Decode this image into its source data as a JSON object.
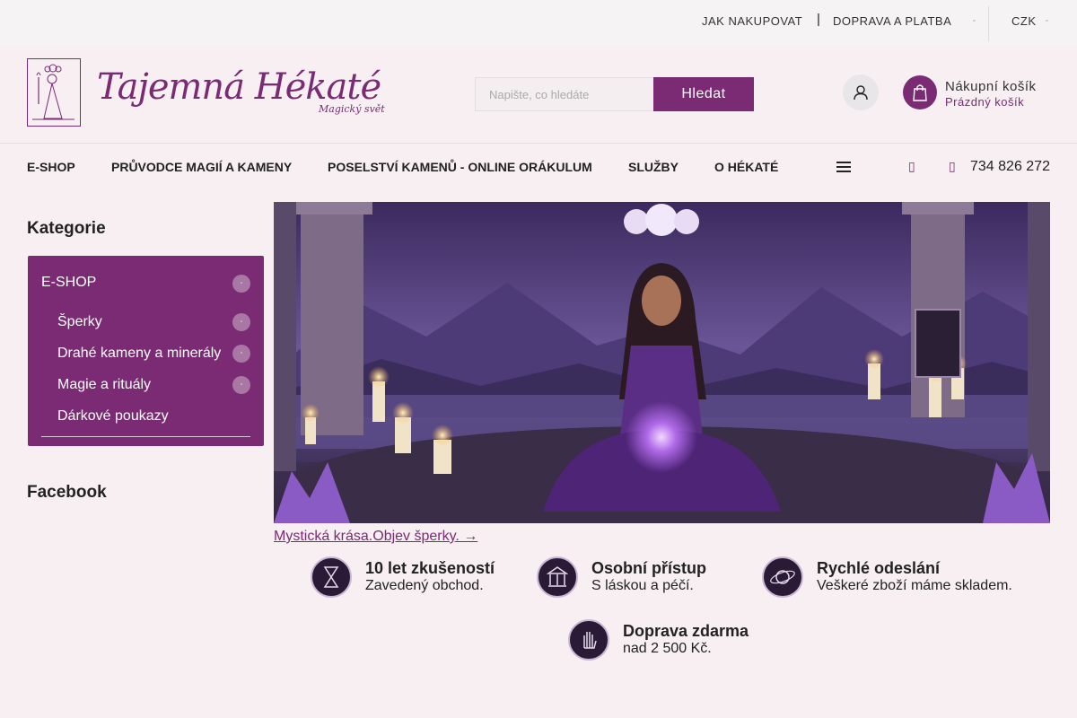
{
  "topbar": {
    "links": [
      "JAK NAKUPOVAT",
      "DOPRAVA A PLATBA"
    ],
    "separator": "|",
    "currency": "CZK",
    "dot": "▫"
  },
  "header": {
    "logo_text": "Tajemná Hékaté",
    "logo_subtitle": "Magický svět",
    "search_placeholder": "Napište, co hledáte",
    "search_button": "Hledat",
    "cart_title": "Nákupní košík",
    "cart_status": "Prázdný košík"
  },
  "nav": {
    "items": [
      "E-SHOP",
      "PRŮVODCE MAGIÍ A KAMENY",
      "POSELSTVÍ KAMENŮ - ONLINE ORÁKULUM",
      "SLUŽBY",
      "O HÉKATÉ"
    ],
    "icon_glyph": "▯",
    "phone": "734 826 272"
  },
  "sidebar": {
    "categories_title": "Kategorie",
    "root": "E-SHOP",
    "items": [
      "Šperky",
      "Drahé kameny a minerály",
      "Magie a rituály",
      "Dárkové poukazy"
    ],
    "expand_glyph": "▫",
    "facebook_title": "Facebook"
  },
  "hero": {
    "link_text": "Mystická krása.Objev šperky. →"
  },
  "features": [
    {
      "title": "10 let zkušeností",
      "subtitle": "Zavedený obchod."
    },
    {
      "title": "Osobní přístup",
      "subtitle": "S láskou a péčí."
    },
    {
      "title": "Rychlé odeslání",
      "subtitle": "Veškeré zboží máme skladem."
    },
    {
      "title": "Doprava zdarma",
      "subtitle": "nad 2 500 Kč."
    }
  ],
  "colors": {
    "brand": "#7a2b73",
    "background": "#f7eff2",
    "topbar": "#f5f3f4"
  },
  "icons": [
    "logo-goddess-icon",
    "user-icon",
    "shopping-bag-icon",
    "menu-icon",
    "hourglass-badge-icon",
    "temple-badge-icon",
    "planet-badge-icon",
    "hand-badge-icon"
  ]
}
